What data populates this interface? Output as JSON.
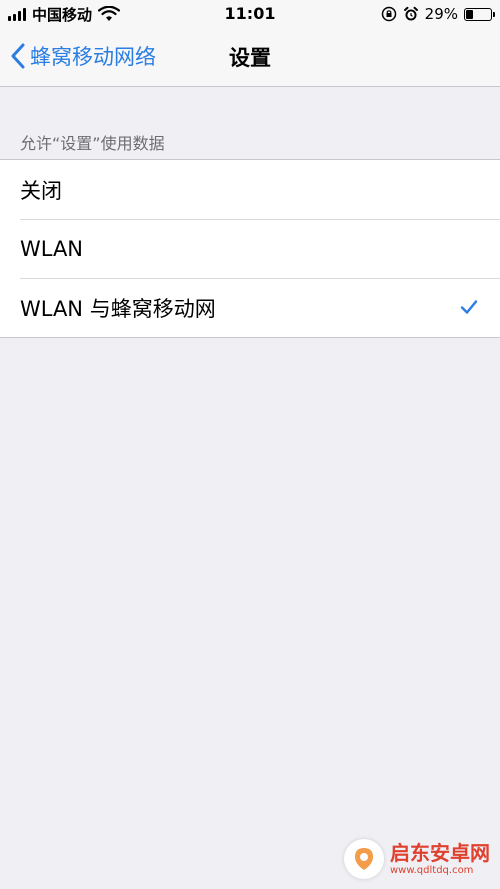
{
  "status_bar": {
    "carrier": "中国移动",
    "time": "11:01",
    "battery_percent": "29%",
    "battery_level": 0.29,
    "icons": [
      "signal-icon",
      "wifi-icon",
      "orientation-lock-icon",
      "alarm-icon",
      "battery-icon"
    ]
  },
  "nav": {
    "back_label": "蜂窝移动网络",
    "title": "设置"
  },
  "section": {
    "header": "允许“设置”使用数据"
  },
  "options": [
    {
      "label": "关闭",
      "selected": false
    },
    {
      "label": "WLAN",
      "selected": false
    },
    {
      "label": "WLAN 与蜂窝移动网",
      "selected": true
    }
  ],
  "colors": {
    "accent": "#2a7de1",
    "background": "#efeff4",
    "watermark": "#e0412e"
  },
  "watermark": {
    "name": "启东安卓网",
    "url": "www.qdltdq.com"
  }
}
